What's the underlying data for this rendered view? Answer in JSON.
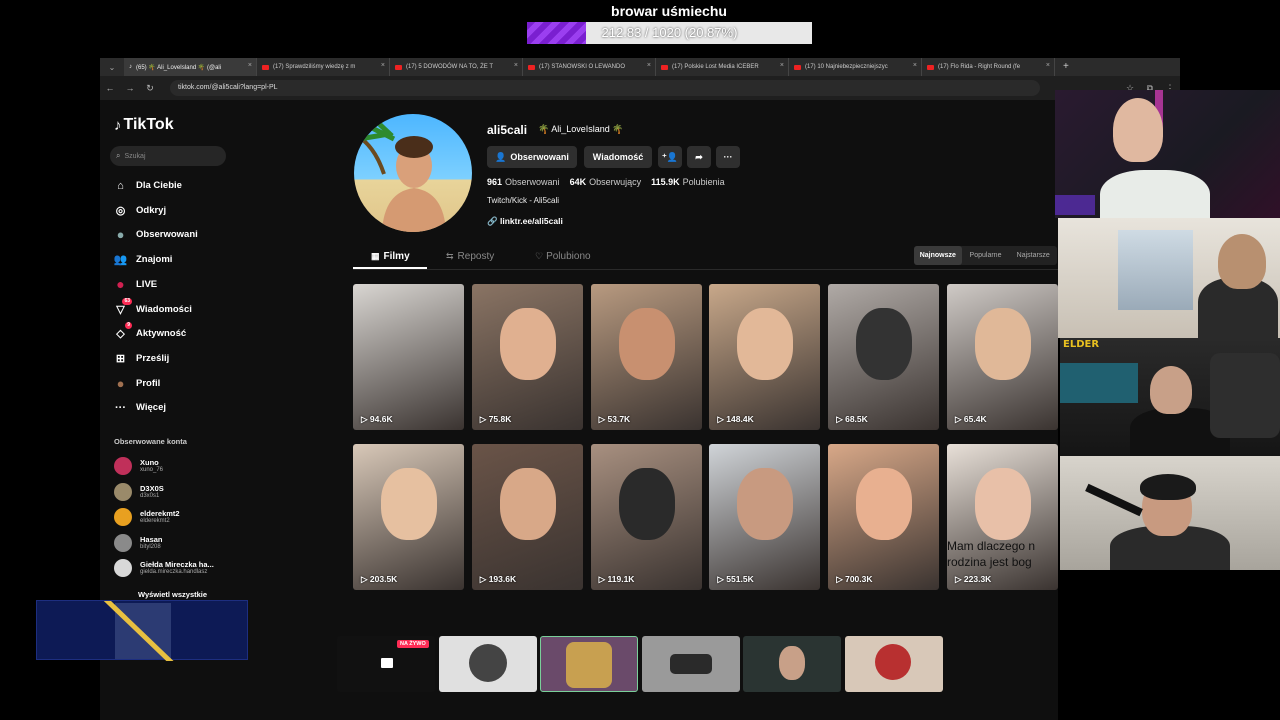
{
  "overlay": {
    "goal_title": "browar uśmiechu",
    "goal_text": "212.83 / 1020 (20.87%)",
    "goal_progress": 0.2087
  },
  "browser": {
    "tabs": [
      {
        "label": "(65) 🌴 Ali_LoveIsland 🌴 (@ali",
        "icon": "tiktok-icon",
        "active": true
      },
      {
        "label": "(17) Sprawdziliśmy wiedzę z m",
        "icon": "youtube-icon"
      },
      {
        "label": "(17) 5 DOWODÓW NA TO, ŻE T",
        "icon": "youtube-icon"
      },
      {
        "label": "(17) STANOWSKI O LEWANDO",
        "icon": "youtube-icon"
      },
      {
        "label": "(17) Polskie Lost Media ICEBER",
        "icon": "youtube-icon"
      },
      {
        "label": "(17) 10 Najniebezpieczniejszyc",
        "icon": "youtube-icon"
      },
      {
        "label": "(17) Flo Rida - Right Round (fe",
        "icon": "youtube-icon"
      }
    ],
    "url": "tiktok.com/@ali5cali?lang=pl-PL"
  },
  "sidebar": {
    "logo": "TikTok",
    "search_placeholder": "Szukaj",
    "nav": [
      {
        "label": "Dla Ciebie",
        "icon": "home-icon"
      },
      {
        "label": "Odkryj",
        "icon": "compass-icon"
      },
      {
        "label": "Obserwowani",
        "icon": "following-icon"
      },
      {
        "label": "Znajomi",
        "icon": "friends-icon"
      },
      {
        "label": "LIVE",
        "icon": "live-icon"
      },
      {
        "label": "Wiadomości",
        "icon": "messages-icon",
        "badge": "63"
      },
      {
        "label": "Aktywność",
        "icon": "activity-icon",
        "badge": "9"
      },
      {
        "label": "Prześlij",
        "icon": "upload-icon"
      },
      {
        "label": "Profil",
        "icon": "profile-icon"
      },
      {
        "label": "Więcej",
        "icon": "more-icon"
      }
    ],
    "followed_title": "Obserwowane konta",
    "accounts": [
      {
        "name": "Xuno",
        "handle": "xuno_76",
        "color": "#c0305a"
      },
      {
        "name": "D3X0S",
        "handle": "d3x0s1",
        "color": "#9a8a6a"
      },
      {
        "name": "elderekmt2",
        "handle": "elderekmt2",
        "color": "#e8a020"
      },
      {
        "name": "Hasan",
        "handle": "bityl208",
        "color": "#8a8a8a"
      },
      {
        "name": "Giełda Mireczka ha...",
        "handle": "gielda.mireczka.handlasz",
        "color": "#d8d8d8"
      }
    ],
    "see_all": "Wyświetl wszystkie"
  },
  "profile": {
    "username": "ali5cali",
    "nickname": "🌴 Ali_LoveIsland 🌴",
    "follow_button": "Obserwowani",
    "message_button": "Wiadomość",
    "stats": [
      {
        "value": "961",
        "label": "Obserwowani"
      },
      {
        "value": "64K",
        "label": "Obserwujący"
      },
      {
        "value": "115.9K",
        "label": "Polubienia"
      }
    ],
    "bio": "Twitch/Kick - Ali5cali",
    "link": "linktr.ee/ali5cali"
  },
  "tabs": {
    "videos": "Filmy",
    "reposts": "Reposty",
    "liked": "Polubiono"
  },
  "sort": {
    "newest": "Najnowsze",
    "popular": "Popularne",
    "oldest": "Najstarsze"
  },
  "videos": [
    {
      "views": "94.6K",
      "bg": "#d9d6d2",
      "face": "none"
    },
    {
      "views": "75.8K",
      "bg": "#8a7464",
      "face": "#e0b090"
    },
    {
      "views": "53.7K",
      "bg": "#b89a80",
      "face": "#c89070"
    },
    {
      "views": "148.4K",
      "bg": "#c8a88a",
      "face": "#e2b898"
    },
    {
      "views": "68.5K",
      "bg": "#b0aaa6",
      "face": "#333"
    },
    {
      "views": "65.4K",
      "bg": "#cfcac6",
      "face": "#e0b898"
    },
    {
      "views": "203.5K",
      "bg": "#d8c8b8",
      "face": "#e6c0a0"
    },
    {
      "views": "193.6K",
      "bg": "#6a5448",
      "face": "#d8a888"
    },
    {
      "views": "119.1K",
      "bg": "#a89080",
      "face": "#2a2a2a"
    },
    {
      "views": "551.5K",
      "bg": "#d0d4d8",
      "face": "#c89a80"
    },
    {
      "views": "700.3K",
      "bg": "#d8a888",
      "face": "#e8b090"
    },
    {
      "views": "223.3K",
      "bg": "#e8e0d8",
      "face": "#e8c0a8",
      "overlay_line1": "Mam dlaczego n",
      "overlay_line2": "rodzina jest bog"
    }
  ],
  "bottom_bar": {
    "live_badge": "NA ŻYWO"
  },
  "webcam_labels": {
    "tag": "ELDER"
  }
}
